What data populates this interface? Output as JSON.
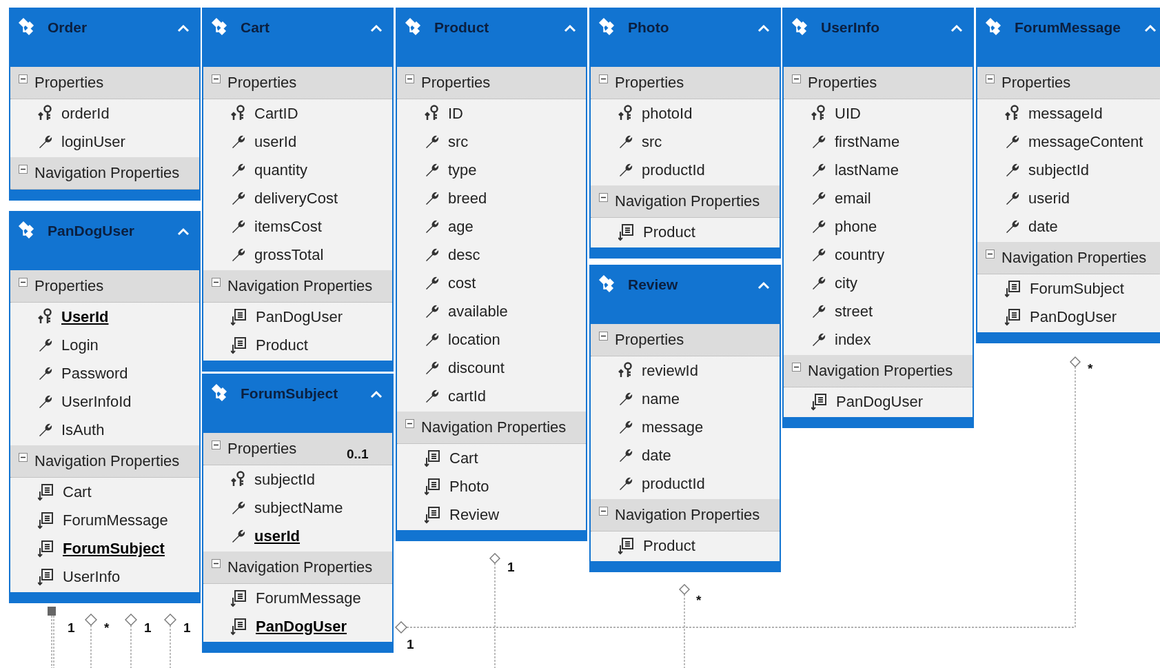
{
  "entities": [
    {
      "title": "Order",
      "sections": [
        {
          "label": "Properties",
          "expanded": true,
          "items": [
            {
              "name": "orderId",
              "kind": "key",
              "highlighted": false
            },
            {
              "name": "loginUser",
              "kind": "property",
              "highlighted": false
            }
          ]
        },
        {
          "label": "Navigation Properties",
          "expanded": true
        }
      ]
    },
    {
      "title": "PanDogUser",
      "sections": [
        {
          "label": "Properties",
          "expanded": true,
          "items": [
            {
              "name": "UserId",
              "kind": "key",
              "highlighted": true
            },
            {
              "name": "Login",
              "kind": "property",
              "highlighted": false
            },
            {
              "name": "Password",
              "kind": "property",
              "highlighted": false
            },
            {
              "name": "UserInfoId",
              "kind": "property",
              "highlighted": false
            },
            {
              "name": "IsAuth",
              "kind": "property",
              "highlighted": false
            }
          ]
        },
        {
          "label": "Navigation Properties",
          "expanded": true,
          "items": [
            {
              "name": "Cart",
              "kind": "navigation",
              "highlighted": false
            },
            {
              "name": "ForumMessage",
              "kind": "navigation",
              "highlighted": false
            },
            {
              "name": "ForumSubject",
              "kind": "navigation",
              "highlighted": true
            },
            {
              "name": "UserInfo",
              "kind": "navigation",
              "highlighted": false
            }
          ]
        }
      ]
    },
    {
      "title": "Cart",
      "sections": [
        {
          "label": "Properties",
          "expanded": true,
          "items": [
            {
              "name": "CartID",
              "kind": "key",
              "highlighted": false
            },
            {
              "name": "userId",
              "kind": "property",
              "highlighted": false
            },
            {
              "name": "quantity",
              "kind": "property",
              "highlighted": false
            },
            {
              "name": "deliveryCost",
              "kind": "property",
              "highlighted": false
            },
            {
              "name": "itemsCost",
              "kind": "property",
              "highlighted": false
            },
            {
              "name": "grossTotal",
              "kind": "property",
              "highlighted": false
            }
          ]
        },
        {
          "label": "Navigation Properties",
          "expanded": true,
          "items": [
            {
              "name": "PanDogUser",
              "kind": "navigation",
              "highlighted": false
            },
            {
              "name": "Product",
              "kind": "navigation",
              "highlighted": false
            }
          ]
        }
      ]
    },
    {
      "title": "ForumSubject",
      "sections": [
        {
          "label": "Properties",
          "expanded": true,
          "items": [
            {
              "name": "subjectId",
              "kind": "key",
              "highlighted": false
            },
            {
              "name": "subjectName",
              "kind": "property",
              "highlighted": false
            },
            {
              "name": "userId",
              "kind": "property",
              "highlighted": true
            }
          ]
        },
        {
          "label": "Navigation Properties",
          "expanded": true,
          "items": [
            {
              "name": "ForumMessage",
              "kind": "navigation",
              "highlighted": false
            },
            {
              "name": "PanDogUser",
              "kind": "navigation",
              "highlighted": true
            }
          ]
        }
      ]
    },
    {
      "title": "Product",
      "sections": [
        {
          "label": "Properties",
          "expanded": true,
          "items": [
            {
              "name": "ID",
              "kind": "key",
              "highlighted": false
            },
            {
              "name": "src",
              "kind": "property",
              "highlighted": false
            },
            {
              "name": "type",
              "kind": "property",
              "highlighted": false
            },
            {
              "name": "breed",
              "kind": "property",
              "highlighted": false
            },
            {
              "name": "age",
              "kind": "property",
              "highlighted": false
            },
            {
              "name": "desc",
              "kind": "property",
              "highlighted": false
            },
            {
              "name": "cost",
              "kind": "property",
              "highlighted": false
            },
            {
              "name": "available",
              "kind": "property",
              "highlighted": false
            },
            {
              "name": "location",
              "kind": "property",
              "highlighted": false
            },
            {
              "name": "discount",
              "kind": "property",
              "highlighted": false
            },
            {
              "name": "cartId",
              "kind": "property",
              "highlighted": false
            }
          ]
        },
        {
          "label": "Navigation Properties",
          "expanded": true,
          "items": [
            {
              "name": "Cart",
              "kind": "navigation",
              "highlighted": false
            },
            {
              "name": "Photo",
              "kind": "navigation",
              "highlighted": false
            },
            {
              "name": "Review",
              "kind": "navigation",
              "highlighted": false
            }
          ]
        }
      ]
    },
    {
      "title": "Photo",
      "sections": [
        {
          "label": "Properties",
          "expanded": true,
          "items": [
            {
              "name": "photoId",
              "kind": "key",
              "highlighted": false
            },
            {
              "name": "src",
              "kind": "property",
              "highlighted": false
            },
            {
              "name": "productId",
              "kind": "property",
              "highlighted": false
            }
          ]
        },
        {
          "label": "Navigation Properties",
          "expanded": true,
          "items": [
            {
              "name": "Product",
              "kind": "navigation",
              "highlighted": false
            }
          ]
        }
      ]
    },
    {
      "title": "Review",
      "sections": [
        {
          "label": "Properties",
          "expanded": true,
          "items": [
            {
              "name": "reviewId",
              "kind": "key",
              "highlighted": false
            },
            {
              "name": "name",
              "kind": "property",
              "highlighted": false
            },
            {
              "name": "message",
              "kind": "property",
              "highlighted": false
            },
            {
              "name": "date",
              "kind": "property",
              "highlighted": false
            },
            {
              "name": "productId",
              "kind": "property",
              "highlighted": false
            }
          ]
        },
        {
          "label": "Navigation Properties",
          "expanded": true,
          "items": [
            {
              "name": "Product",
              "kind": "navigation",
              "highlighted": false
            }
          ]
        }
      ]
    },
    {
      "title": "UserInfo",
      "sections": [
        {
          "label": "Properties",
          "expanded": true,
          "items": [
            {
              "name": "UID",
              "kind": "key",
              "highlighted": false
            },
            {
              "name": "firstName",
              "kind": "property",
              "highlighted": false
            },
            {
              "name": "lastName",
              "kind": "property",
              "highlighted": false
            },
            {
              "name": "email",
              "kind": "property",
              "highlighted": false
            },
            {
              "name": "phone",
              "kind": "property",
              "highlighted": false
            },
            {
              "name": "country",
              "kind": "property",
              "highlighted": false
            },
            {
              "name": "city",
              "kind": "property",
              "highlighted": false
            },
            {
              "name": "street",
              "kind": "property",
              "highlighted": false
            },
            {
              "name": "index",
              "kind": "property",
              "highlighted": false
            }
          ]
        },
        {
          "label": "Navigation Properties",
          "expanded": true,
          "items": [
            {
              "name": "PanDogUser",
              "kind": "navigation",
              "highlighted": false
            }
          ]
        }
      ]
    },
    {
      "title": "ForumMessage",
      "sections": [
        {
          "label": "Properties",
          "expanded": true,
          "items": [
            {
              "name": "messageId",
              "kind": "key",
              "highlighted": false
            },
            {
              "name": "messageContent",
              "kind": "property",
              "highlighted": false
            },
            {
              "name": "subjectId",
              "kind": "property",
              "highlighted": false
            },
            {
              "name": "userid",
              "kind": "property",
              "highlighted": false
            },
            {
              "name": "date",
              "kind": "property",
              "highlighted": false
            }
          ]
        },
        {
          "label": "Navigation Properties",
          "expanded": true,
          "items": [
            {
              "name": "ForumSubject",
              "kind": "navigation",
              "highlighted": false
            },
            {
              "name": "PanDogUser",
              "kind": "navigation",
              "highlighted": false
            }
          ]
        }
      ]
    }
  ],
  "multiplicities": [
    "1",
    "*",
    "1",
    "1",
    "0..1",
    "1",
    "*",
    "1",
    "*"
  ]
}
